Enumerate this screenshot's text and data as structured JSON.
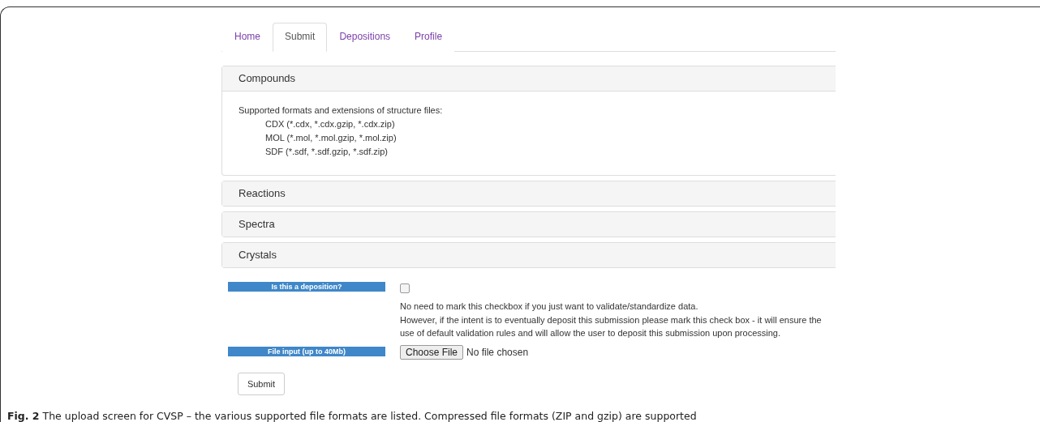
{
  "tabs": [
    {
      "label": "Home",
      "selected": false
    },
    {
      "label": "Submit",
      "selected": true
    },
    {
      "label": "Depositions",
      "selected": false
    },
    {
      "label": "Profile",
      "selected": false
    }
  ],
  "panels": [
    {
      "title": "Compounds",
      "expanded": true,
      "intro": "Supported formats and extensions of structure files:",
      "formats": [
        "CDX (*.cdx, *.cdx.gzip, *.cdx.zip)",
        "MOL (*.mol, *.mol.gzip, *.mol.zip)",
        "SDF (*.sdf, *.sdf.gzip, *.sdf.zip)"
      ]
    },
    {
      "title": "Reactions",
      "expanded": false
    },
    {
      "title": "Spectra",
      "expanded": false
    },
    {
      "title": "Crystals",
      "expanded": false
    }
  ],
  "deposition": {
    "label": "Is this a deposition?",
    "checked": false,
    "notes": [
      "No need to mark this checkbox if you just want to validate/standardize data.",
      "However, if the intent is to eventually deposit this submission please mark this check box - it will ensure the use of default validation rules and will allow the user to deposit this submission upon processing."
    ]
  },
  "file_input": {
    "label": "File input (up to 40Mb)",
    "button": "Choose File",
    "status": "No file chosen"
  },
  "submit_button": "Submit",
  "caption": "**Fig. 2** The upload screen for CVSP – the various supported file formats are listed. Compressed file formats (ZIP and gzip) are supported"
}
